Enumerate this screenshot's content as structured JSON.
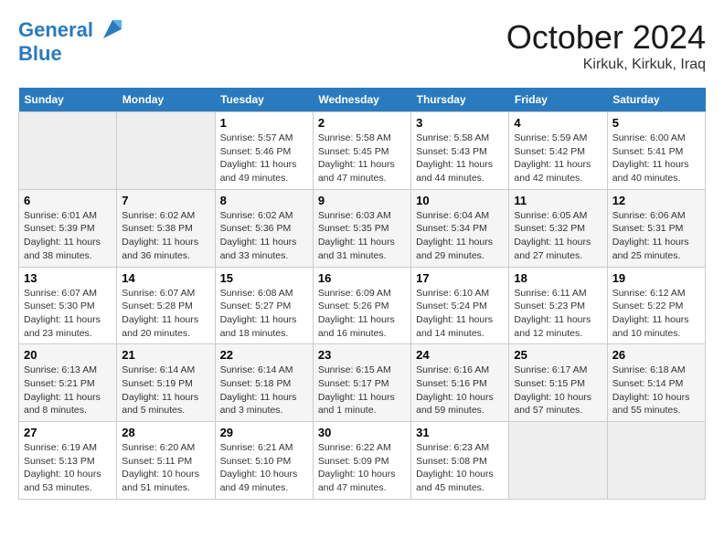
{
  "header": {
    "logo_line1": "General",
    "logo_line2": "Blue",
    "month_title": "October 2024",
    "location": "Kirkuk, Kirkuk, Iraq"
  },
  "weekdays": [
    "Sunday",
    "Monday",
    "Tuesday",
    "Wednesday",
    "Thursday",
    "Friday",
    "Saturday"
  ],
  "weeks": [
    [
      {
        "day": "",
        "info": ""
      },
      {
        "day": "",
        "info": ""
      },
      {
        "day": "1",
        "info": "Sunrise: 5:57 AM\nSunset: 5:46 PM\nDaylight: 11 hours and 49 minutes."
      },
      {
        "day": "2",
        "info": "Sunrise: 5:58 AM\nSunset: 5:45 PM\nDaylight: 11 hours and 47 minutes."
      },
      {
        "day": "3",
        "info": "Sunrise: 5:58 AM\nSunset: 5:43 PM\nDaylight: 11 hours and 44 minutes."
      },
      {
        "day": "4",
        "info": "Sunrise: 5:59 AM\nSunset: 5:42 PM\nDaylight: 11 hours and 42 minutes."
      },
      {
        "day": "5",
        "info": "Sunrise: 6:00 AM\nSunset: 5:41 PM\nDaylight: 11 hours and 40 minutes."
      }
    ],
    [
      {
        "day": "6",
        "info": "Sunrise: 6:01 AM\nSunset: 5:39 PM\nDaylight: 11 hours and 38 minutes."
      },
      {
        "day": "7",
        "info": "Sunrise: 6:02 AM\nSunset: 5:38 PM\nDaylight: 11 hours and 36 minutes."
      },
      {
        "day": "8",
        "info": "Sunrise: 6:02 AM\nSunset: 5:36 PM\nDaylight: 11 hours and 33 minutes."
      },
      {
        "day": "9",
        "info": "Sunrise: 6:03 AM\nSunset: 5:35 PM\nDaylight: 11 hours and 31 minutes."
      },
      {
        "day": "10",
        "info": "Sunrise: 6:04 AM\nSunset: 5:34 PM\nDaylight: 11 hours and 29 minutes."
      },
      {
        "day": "11",
        "info": "Sunrise: 6:05 AM\nSunset: 5:32 PM\nDaylight: 11 hours and 27 minutes."
      },
      {
        "day": "12",
        "info": "Sunrise: 6:06 AM\nSunset: 5:31 PM\nDaylight: 11 hours and 25 minutes."
      }
    ],
    [
      {
        "day": "13",
        "info": "Sunrise: 6:07 AM\nSunset: 5:30 PM\nDaylight: 11 hours and 23 minutes."
      },
      {
        "day": "14",
        "info": "Sunrise: 6:07 AM\nSunset: 5:28 PM\nDaylight: 11 hours and 20 minutes."
      },
      {
        "day": "15",
        "info": "Sunrise: 6:08 AM\nSunset: 5:27 PM\nDaylight: 11 hours and 18 minutes."
      },
      {
        "day": "16",
        "info": "Sunrise: 6:09 AM\nSunset: 5:26 PM\nDaylight: 11 hours and 16 minutes."
      },
      {
        "day": "17",
        "info": "Sunrise: 6:10 AM\nSunset: 5:24 PM\nDaylight: 11 hours and 14 minutes."
      },
      {
        "day": "18",
        "info": "Sunrise: 6:11 AM\nSunset: 5:23 PM\nDaylight: 11 hours and 12 minutes."
      },
      {
        "day": "19",
        "info": "Sunrise: 6:12 AM\nSunset: 5:22 PM\nDaylight: 11 hours and 10 minutes."
      }
    ],
    [
      {
        "day": "20",
        "info": "Sunrise: 6:13 AM\nSunset: 5:21 PM\nDaylight: 11 hours and 8 minutes."
      },
      {
        "day": "21",
        "info": "Sunrise: 6:14 AM\nSunset: 5:19 PM\nDaylight: 11 hours and 5 minutes."
      },
      {
        "day": "22",
        "info": "Sunrise: 6:14 AM\nSunset: 5:18 PM\nDaylight: 11 hours and 3 minutes."
      },
      {
        "day": "23",
        "info": "Sunrise: 6:15 AM\nSunset: 5:17 PM\nDaylight: 11 hours and 1 minute."
      },
      {
        "day": "24",
        "info": "Sunrise: 6:16 AM\nSunset: 5:16 PM\nDaylight: 10 hours and 59 minutes."
      },
      {
        "day": "25",
        "info": "Sunrise: 6:17 AM\nSunset: 5:15 PM\nDaylight: 10 hours and 57 minutes."
      },
      {
        "day": "26",
        "info": "Sunrise: 6:18 AM\nSunset: 5:14 PM\nDaylight: 10 hours and 55 minutes."
      }
    ],
    [
      {
        "day": "27",
        "info": "Sunrise: 6:19 AM\nSunset: 5:13 PM\nDaylight: 10 hours and 53 minutes."
      },
      {
        "day": "28",
        "info": "Sunrise: 6:20 AM\nSunset: 5:11 PM\nDaylight: 10 hours and 51 minutes."
      },
      {
        "day": "29",
        "info": "Sunrise: 6:21 AM\nSunset: 5:10 PM\nDaylight: 10 hours and 49 minutes."
      },
      {
        "day": "30",
        "info": "Sunrise: 6:22 AM\nSunset: 5:09 PM\nDaylight: 10 hours and 47 minutes."
      },
      {
        "day": "31",
        "info": "Sunrise: 6:23 AM\nSunset: 5:08 PM\nDaylight: 10 hours and 45 minutes."
      },
      {
        "day": "",
        "info": ""
      },
      {
        "day": "",
        "info": ""
      }
    ]
  ]
}
